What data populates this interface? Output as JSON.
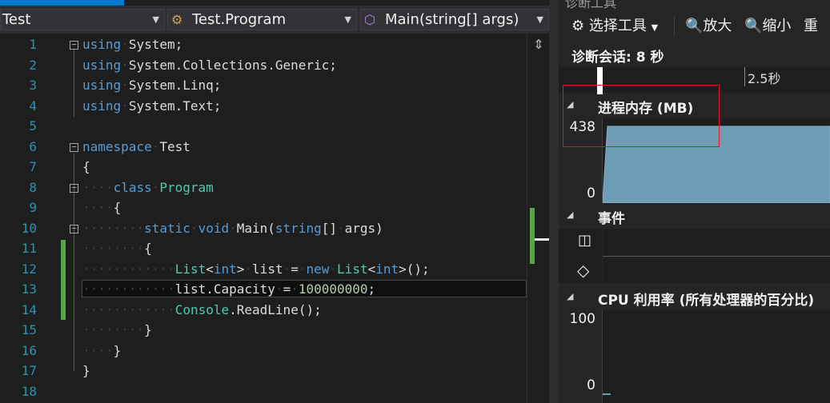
{
  "editor": {
    "nav": {
      "project": "Test",
      "class": "Test.Program",
      "member": "Main(string[] args)"
    },
    "line_numbers": [
      "1",
      "2",
      "3",
      "4",
      "5",
      "6",
      "7",
      "8",
      "9",
      "10",
      "11",
      "12",
      "13",
      "14",
      "15",
      "16",
      "17",
      "18"
    ],
    "lines": [
      "using System;",
      "using System.Collections.Generic;",
      "using System.Linq;",
      "using System.Text;",
      "",
      "namespace Test",
      "{",
      "    class Program",
      "    {",
      "        static void Main(string[] args)",
      "        {",
      "            List<int> list = new List<int>();",
      "            list.Capacity = 100000000;",
      "            Console.ReadLine();",
      "        }",
      "    }",
      "}",
      ""
    ],
    "colors": {
      "keyword": "#569cd6",
      "type": "#4ec9b0",
      "number": "#b5cea8",
      "line_number": "#2b91af",
      "changed": "#57a64a"
    }
  },
  "diagnostics": {
    "window_title": "诊断工具",
    "toolbar": {
      "select_tools": "选择工具",
      "zoom_in": "放大",
      "zoom_out": "缩小",
      "reset": "重"
    },
    "session": "诊断会话: 8 秒",
    "timeline_tick": "2.5秒",
    "memory": {
      "title": "进程内存 (MB)",
      "max": "438",
      "min": "0"
    },
    "events": {
      "title": "事件"
    },
    "cpu": {
      "title": "CPU 利用率 (所有处理器的百分比)",
      "max": "100",
      "min": "0"
    },
    "colors": {
      "memory_fill": "#6d9cb5",
      "highlight": "#e81123"
    }
  }
}
